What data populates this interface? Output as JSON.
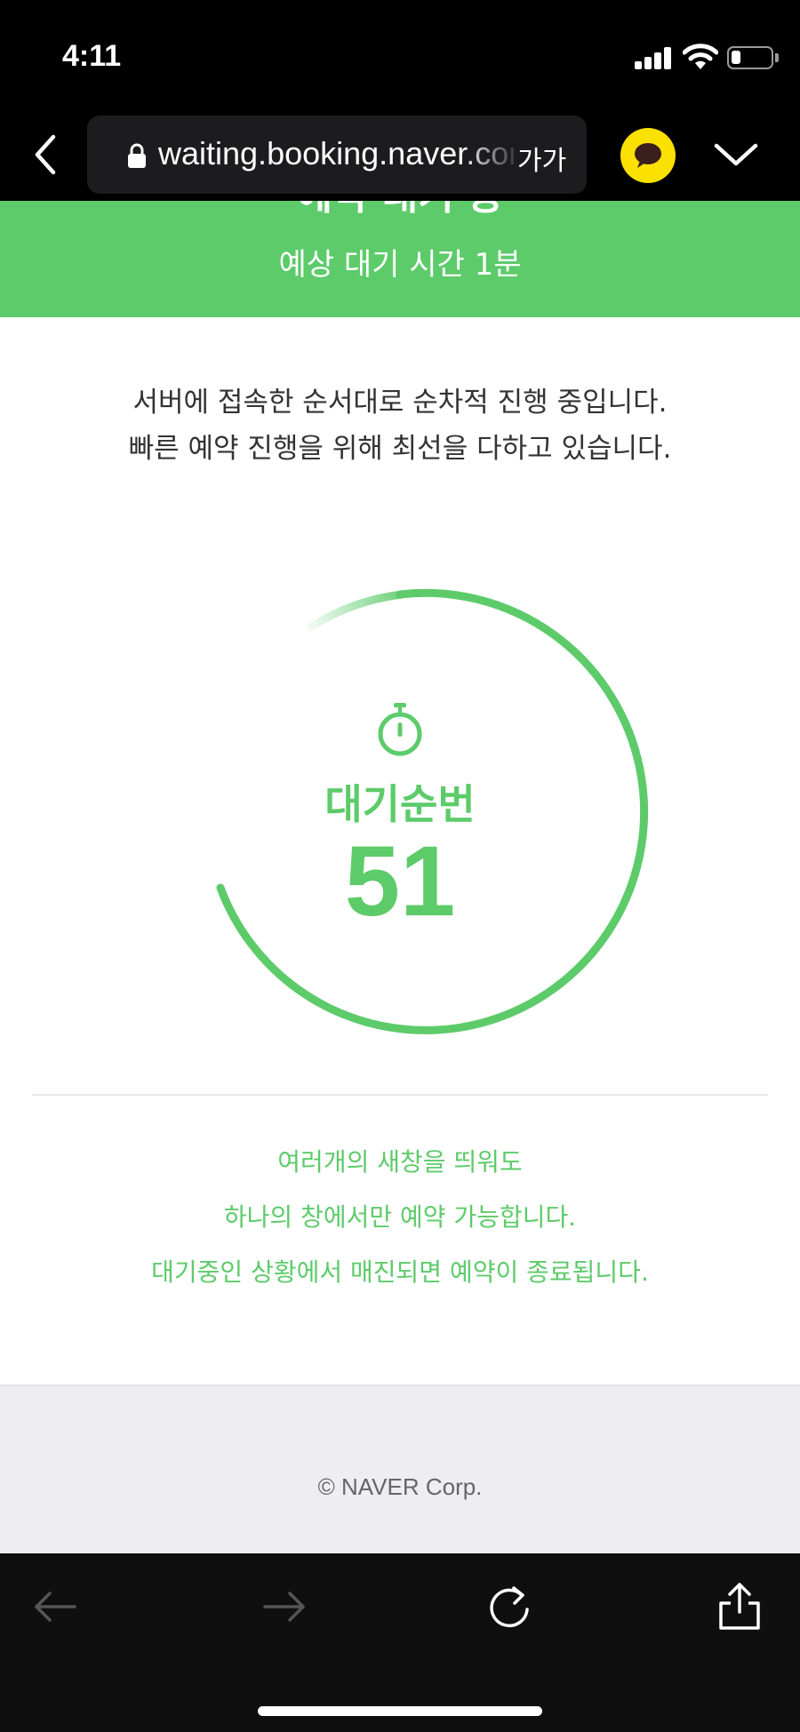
{
  "status_bar": {
    "time": "4:11"
  },
  "browser": {
    "url": "waiting.booking.naver.com",
    "text_size_label": "가가"
  },
  "header": {
    "title": "예약 대기 중",
    "subtitle": "예상 대기 시간 1분"
  },
  "intro": {
    "line1": "서버에 접속한 순서대로 순차적 진행 중입니다.",
    "line2": "빠른 예약 진행을 위해 최선을 다하고 있습니다."
  },
  "queue": {
    "label": "대기순번",
    "number": "51"
  },
  "notice": {
    "line1": "여러개의 새창을 띄워도",
    "line2": "하나의 창에서만 예약 가능합니다.",
    "line3": "대기중인 상황에서 매진되면 예약이 종료됩니다."
  },
  "footer": {
    "copyright": "© NAVER Corp."
  },
  "colors": {
    "accent": "#5dcb6a",
    "kakao": "#fae100"
  },
  "icons": [
    "back-chevron-icon",
    "lock-icon",
    "kakao-talk-icon",
    "chevron-down-icon",
    "stopwatch-icon",
    "arrow-left-icon",
    "arrow-right-icon",
    "reload-icon",
    "share-icon"
  ]
}
